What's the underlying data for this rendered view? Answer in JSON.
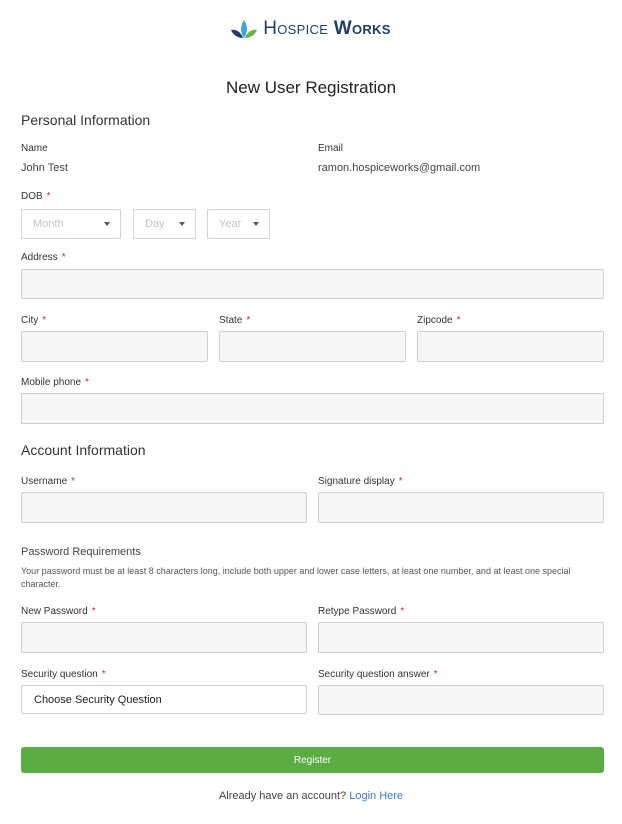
{
  "brand": {
    "name_part1": "Hospice",
    "name_part2": "Works",
    "leaf_colors": [
      "#1e3f6e",
      "#3aa7d8",
      "#69b545"
    ]
  },
  "page_title": "New User Registration",
  "personal": {
    "heading": "Personal Information",
    "name_label": "Name",
    "name_value": "John Test",
    "email_label": "Email",
    "email_value": "ramon.hospiceworks@gmail.com",
    "dob_label": "DOB",
    "dob_month": "Month",
    "dob_day": "Day",
    "dob_year": "Year",
    "address_label": "Address",
    "city_label": "City",
    "state_label": "State",
    "zip_label": "Zipcode",
    "mobile_label": "Mobile phone"
  },
  "account": {
    "heading": "Account Information",
    "username_label": "Username",
    "signature_label": "Signature display",
    "pw_req_heading": "Password Requirements",
    "pw_req_text": "Your password must be at least 8 characters long, include both upper and lower case letters, at least one number, and at least one special character.",
    "new_pw_label": "New Password",
    "retype_pw_label": "Retype Password",
    "sec_q_label": "Security question",
    "sec_q_value": "Choose Security Question",
    "sec_a_label": "Security question answer"
  },
  "required_mark": "*",
  "register_label": "Register",
  "footer": {
    "text": "Already have an account?",
    "link": "Login Here"
  },
  "colors": {
    "primary_button": "#5aac43",
    "required": "#d9232d",
    "link": "#3a7bd5",
    "brand_text": "#1f3d6b"
  }
}
